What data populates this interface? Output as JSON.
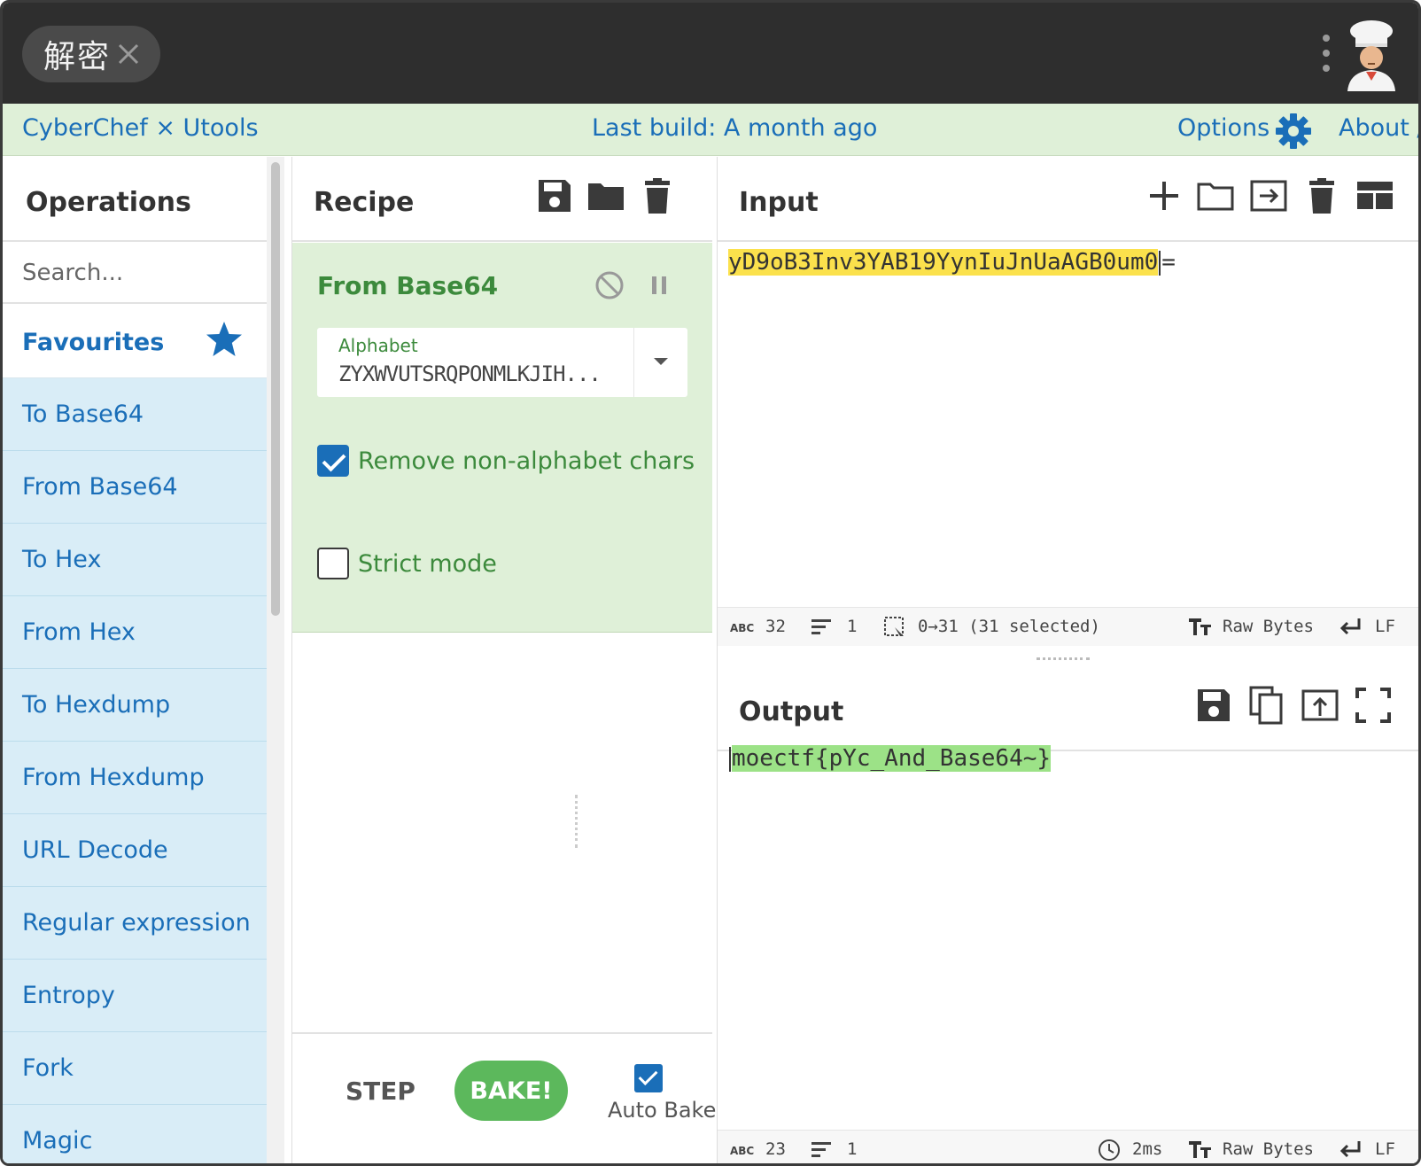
{
  "window": {
    "tab_label": "解密"
  },
  "banner": {
    "app_name": "CyberChef × Utools",
    "build_info": "Last build: A month ago",
    "options_label": "Options",
    "about_label": "About /"
  },
  "operations": {
    "title": "Operations",
    "search_placeholder": "Search...",
    "favourites_label": "Favourites",
    "items": [
      {
        "label": "To Base64"
      },
      {
        "label": "From Base64"
      },
      {
        "label": "To Hex"
      },
      {
        "label": "From Hex"
      },
      {
        "label": "To Hexdump"
      },
      {
        "label": "From Hexdump"
      },
      {
        "label": "URL Decode"
      },
      {
        "label": "Regular expression"
      },
      {
        "label": "Entropy"
      },
      {
        "label": "Fork"
      },
      {
        "label": "Magic"
      }
    ]
  },
  "recipe": {
    "title": "Recipe",
    "operation": {
      "name": "From Base64",
      "alphabet_label": "Alphabet",
      "alphabet_value": "ZYXWVUTSRQPONMLKJIH...",
      "remove_non_alphabet_label": "Remove non-alphabet chars",
      "remove_non_alphabet_checked": true,
      "strict_mode_label": "Strict mode",
      "strict_mode_checked": false
    },
    "step_label": "STEP",
    "bake_label": "BAKE!",
    "auto_bake_label": "Auto Bake",
    "auto_bake_checked": true
  },
  "input": {
    "title": "Input",
    "text_selected": "yD9oB3Inv3YAB19YynIuJnUaAGB0um0",
    "text_rest": "=",
    "status": {
      "abc_label": "ABC",
      "length": "32",
      "lines": "1",
      "selection": "0→31 (31 selected)",
      "encoding": "Raw Bytes",
      "eol": "LF"
    }
  },
  "output": {
    "title": "Output",
    "text": "moectf{pYc_And_Base64~}",
    "status": {
      "abc_label": "ABC",
      "length": "23",
      "lines": "1",
      "time": "2ms",
      "encoding": "Raw Bytes",
      "eol": "LF"
    }
  },
  "colors": {
    "accent_blue": "#1a6eb8",
    "recipe_green_bg": "#dff0d8",
    "operation_green_text": "#3c8a3c",
    "op_item_bg": "#d9edf7",
    "bake_green": "#5cb85c",
    "input_highlight": "#fbe14c",
    "output_highlight": "#9ce287",
    "titlebar": "#2e2e2e"
  },
  "icons": {
    "tab_close": "close-icon",
    "menu": "kebab-menu-icon",
    "user": "chef-avatar-icon",
    "options": "gear-icon",
    "favourites": "star-icon",
    "recipe_actions": [
      "save-icon",
      "folder-icon",
      "trash-icon"
    ],
    "input_actions": [
      "plus-icon",
      "folder-icon",
      "import-icon",
      "trash-icon",
      "layout-icon"
    ],
    "output_actions": [
      "save-icon",
      "copy-icon",
      "upload-icon",
      "fullscreen-icon"
    ]
  }
}
